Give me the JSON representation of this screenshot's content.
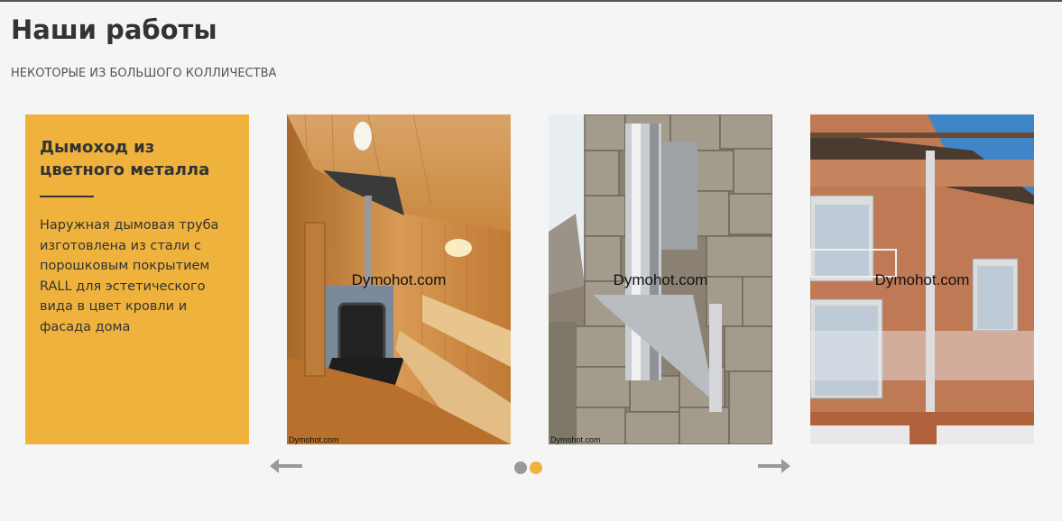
{
  "header": {
    "title": "Наши работы",
    "subtitle": "НЕКОТОРЫЕ ИЗ БОЛЬШОГО КОЛЛИЧЕСТВА"
  },
  "card": {
    "title": "Дымоход из цветного металла",
    "description": "Наружная дымовая труба изготовлена из стали с порошковым покрытием RALL для эстетического вида в цвет кровли и фасада дома",
    "color": "#efb23d"
  },
  "slides": [
    {
      "watermark": "Dymohot.com",
      "caption": "Dymohot.com",
      "scene": "sauna"
    },
    {
      "watermark": "Dymohot.com",
      "caption": "Dymohot.com",
      "scene": "stone-wall-chimney"
    },
    {
      "watermark": "Dymohot.com",
      "scene": "house-facade"
    }
  ],
  "carousel": {
    "prev_icon": "arrow-left-icon",
    "next_icon": "arrow-right-icon",
    "dots": [
      {
        "state": "inactive",
        "color": "#999999"
      },
      {
        "state": "active",
        "color": "#efb23d"
      }
    ]
  }
}
